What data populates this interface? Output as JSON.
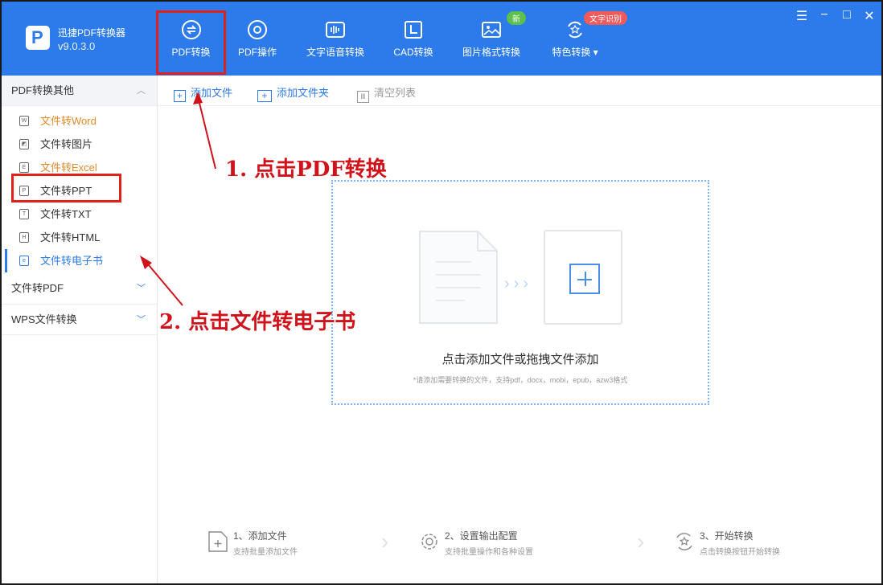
{
  "app": {
    "name": "迅捷PDF转换器",
    "version": "v9.0.3.0",
    "logo_letter": "P"
  },
  "tabs": [
    {
      "label": "PDF转换",
      "icon": "convert-icon",
      "active": true
    },
    {
      "label": "PDF操作",
      "icon": "operation-icon"
    },
    {
      "label": "文字语音转换",
      "icon": "audio-wave-icon"
    },
    {
      "label": "CAD转换",
      "icon": "cad-icon"
    },
    {
      "label": "图片格式转换",
      "icon": "image-icon"
    },
    {
      "label": "特色转换 ▾",
      "icon": "special-convert-icon"
    }
  ],
  "badges": {
    "new": "新",
    "ocr": "文字识别"
  },
  "window": {
    "menu": "☰",
    "minimize": "−",
    "maximize": "□",
    "close": "✕"
  },
  "sidebar": {
    "group1": {
      "label": "PDF转换其他",
      "chevron": "︿"
    },
    "items": [
      {
        "label": "文件转Word",
        "icon_text": "W"
      },
      {
        "label": "文件转图片",
        "icon_text": "◩"
      },
      {
        "label": "文件转Excel",
        "icon_text": "E"
      },
      {
        "label": "文件转PPT",
        "icon_text": "P"
      },
      {
        "label": "文件转TXT",
        "icon_text": "T"
      },
      {
        "label": "文件转HTML",
        "icon_text": "H"
      },
      {
        "label": "文件转电子书",
        "icon_text": "e"
      }
    ],
    "group2": {
      "label": "文件转PDF",
      "chevron": "﹀"
    },
    "group3": {
      "label": "WPS文件转换",
      "chevron": "﹀"
    }
  },
  "toolbar": {
    "add_file": "添加文件",
    "add_folder": "添加文件夹",
    "clear_list": "清空列表"
  },
  "dropzone": {
    "title": "点击添加文件或拖拽文件添加",
    "subtitle": "*请添加需要转换的文件，支持pdf，docx，mobi，epub，azw3格式",
    "arrows": "›››"
  },
  "steps": [
    {
      "title": "1、添加文件",
      "subtitle": "支持批量添加文件"
    },
    {
      "title": "2、设置输出配置",
      "subtitle": "支持批量操作和各种设置"
    },
    {
      "title": "3、开始转换",
      "subtitle": "点击转换按钮开始转换"
    }
  ],
  "annotations": {
    "step1": "1. 点击PDF转换",
    "step2": "2. 点击文件转电子书"
  },
  "colors": {
    "primary": "#2d7bea",
    "annotation": "#d0121b",
    "orange": "#e08a2a",
    "badge_new": "#5cc04a",
    "badge_ocr": "#f05a5a"
  }
}
